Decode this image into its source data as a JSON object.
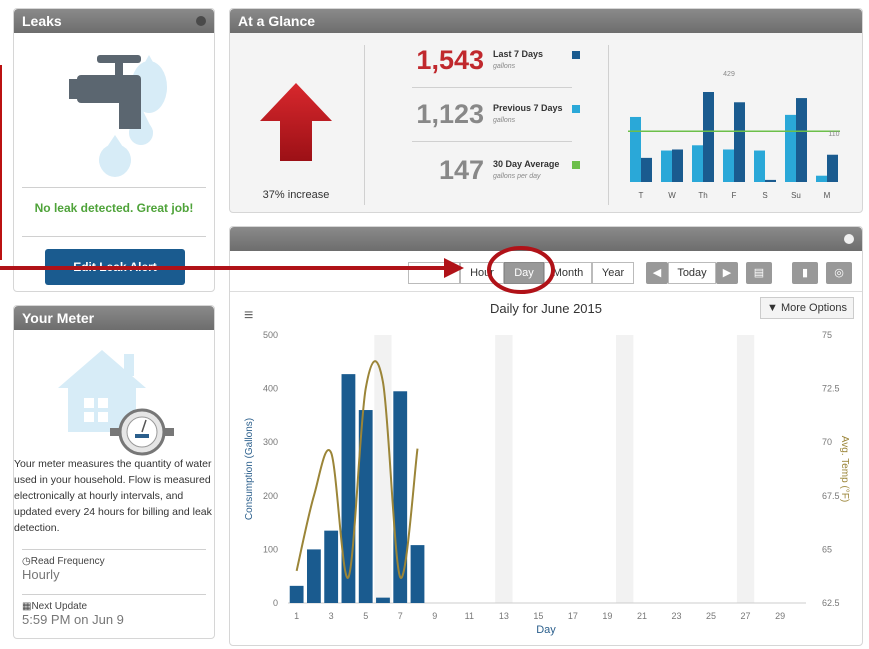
{
  "leaks": {
    "title": "Leaks",
    "status": "No leak detected. Great job!",
    "edit_button": "Edit Leak Alert"
  },
  "meter": {
    "title": "Your Meter",
    "description": "Your meter measures the quantity of water used in your household. Flow is measured electronically at hourly intervals, and updated every 24 hours for billing and leak detection.",
    "read_label": "Read Frequency",
    "read_value": "Hourly",
    "update_label": "Next Update",
    "update_value": "5:59 PM on Jun 9"
  },
  "glance": {
    "title": "At a Glance",
    "increase": "37% increase",
    "stats": [
      {
        "value": "1,543",
        "label": "Last 7 Days",
        "sub": "gallons",
        "color": "#c0282d",
        "swatch": "#1a5b8f"
      },
      {
        "value": "1,123",
        "label": "Previous 7 Days",
        "sub": "gallons",
        "color": "#888888",
        "swatch": "#2aa8d8"
      },
      {
        "value": "147",
        "label": "30 Day Average",
        "sub": "gallons per day",
        "color": "#888888",
        "swatch": "#6cbf4a"
      }
    ],
    "mini_labels": {
      "peak": "429",
      "avg": "110"
    }
  },
  "controls": {
    "hour": "Hour",
    "day": "Day",
    "month": "Month",
    "year": "Year",
    "today": "Today",
    "more_options": "▼ More Options"
  },
  "chart_data": [
    {
      "type": "bar",
      "title": "",
      "categories": [
        "T",
        "W",
        "Th",
        "F",
        "S",
        "Su",
        "M"
      ],
      "series": [
        {
          "name": "Previous 7 Days",
          "values": [
            310,
            150,
            175,
            155,
            150,
            320,
            30
          ]
        },
        {
          "name": "Last 7 Days",
          "values": [
            115,
            155,
            429,
            380,
            10,
            400,
            130
          ]
        }
      ],
      "average_line": 110,
      "colors": {
        "last": "#1a5b8f",
        "previous": "#2aa8d8",
        "avg": "#6cbf4a"
      }
    },
    {
      "type": "bar",
      "title": "Daily for June 2015",
      "xlabel": "Day",
      "ylabel": "Consumption (Gallons)",
      "y2label": "Avg. Temp (°F)",
      "ylim": [
        0,
        500
      ],
      "y2lim": [
        62.5,
        75
      ],
      "yticks": [
        0,
        100,
        200,
        300,
        400,
        500
      ],
      "y2ticks": [
        "62.5",
        "65",
        "67.5",
        "70",
        "72.5",
        "75"
      ],
      "xticks": [
        1,
        3,
        5,
        7,
        9,
        11,
        13,
        15,
        17,
        19,
        21,
        23,
        25,
        27,
        29
      ],
      "x": [
        1,
        2,
        3,
        4,
        5,
        6,
        7,
        8
      ],
      "values": [
        32,
        100,
        135,
        427,
        360,
        10,
        395,
        108
      ],
      "temperature": {
        "x": [
          1,
          2,
          3,
          4,
          5,
          6,
          7,
          8
        ],
        "values": [
          64.0,
          67.5,
          69.5,
          63.7,
          72.5,
          72.8,
          63.7,
          69.7
        ]
      },
      "colors": {
        "bar": "#1a5b8f",
        "temp": "#9b8538"
      }
    }
  ]
}
